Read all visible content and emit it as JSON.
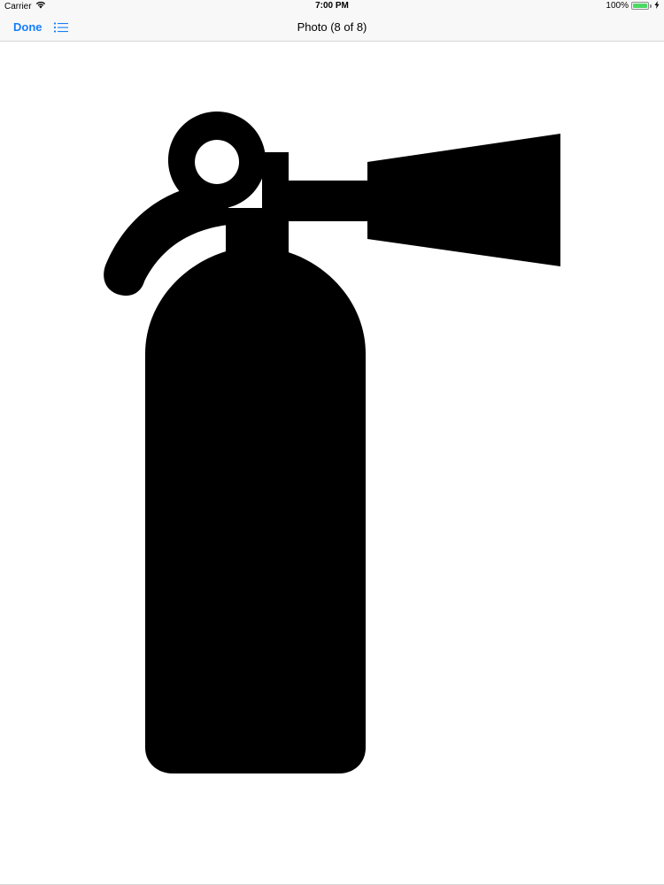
{
  "status_bar": {
    "carrier": "Carrier",
    "time": "7:00 PM",
    "battery_label": "100%",
    "battery_level": 1.0,
    "icons": [
      "wifi-icon",
      "battery-icon",
      "charging-icon"
    ]
  },
  "nav_bar": {
    "done_label": "Done",
    "title": "Photo (8 of 8)",
    "list_icon": "list-icon",
    "accent_color": "#157efb"
  },
  "photo": {
    "subject_icon": "fire-extinguisher-icon",
    "fill_color": "#000000",
    "background_color": "#ffffff"
  }
}
